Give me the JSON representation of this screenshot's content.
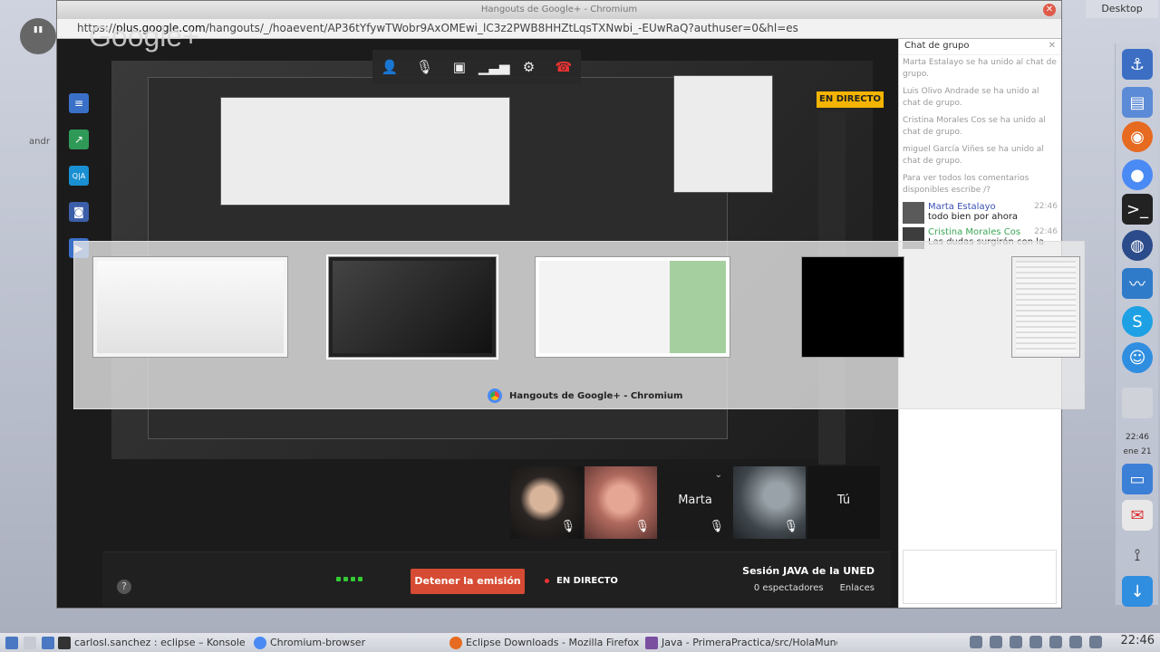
{
  "desktop": {
    "label": "Desktop",
    "left_peek": "andr"
  },
  "window": {
    "title": "Hangouts de Google+ - Chromium",
    "url_prefix": "https://",
    "url_domain": "plus.google.com",
    "url_rest": "/hangouts/_/hoaevent/AP36tYfywTWobr9AxOMEwi_lC3z2PWB8HHZtLqsTXNwbi_-EUwRaQ?authuser=0&hl=es",
    "brand": "Google+"
  },
  "toolbar": {
    "icons": [
      "add-person-icon",
      "mic-off-icon",
      "camera-off-icon",
      "signal-icon",
      "gear-icon",
      "hangup-icon"
    ]
  },
  "stage": {
    "live_badge": "EN DIRECTO"
  },
  "switcher": {
    "selected_label": "Hangouts de Google+ - Chromium"
  },
  "participants": [
    {
      "name": "",
      "muted": true
    },
    {
      "name": "",
      "muted": true
    },
    {
      "name": "Marta",
      "muted": true
    },
    {
      "name": "",
      "muted": true
    },
    {
      "name": "Tú",
      "muted": false
    }
  ],
  "bottombar": {
    "stop_label": "Detener la emisión",
    "live_label": "EN DIRECTO",
    "session_title": "Sesión JAVA de la UNED",
    "viewers": "0 espectadores",
    "links": "Enlaces"
  },
  "chat": {
    "title": "Chat de grupo",
    "system_messages": [
      "Marta Estalayo se ha unido al chat de grupo.",
      "Luis Olivo Andrade se ha unido al chat de grupo.",
      "Cristina Morales Cos se ha unido al chat de grupo.",
      "miguel García Viñes se ha unido al chat de grupo.",
      "Para ver todos los comentarios disponibles escribe /?"
    ],
    "messages": [
      {
        "author": "Marta Estalayo",
        "text": "todo bien por ahora",
        "time": "22:46",
        "color": "#3a4fb5"
      },
      {
        "author": "Cristina Morales Cos",
        "text": "Las dudas surgirán con la",
        "time": "22:46",
        "color": "#3aa757"
      }
    ]
  },
  "dock": {
    "time": "22:46",
    "date": "ene 21"
  },
  "taskbar": {
    "tasks": [
      {
        "label": "carlosl.sanchez : eclipse – Konsole",
        "color": "#333"
      },
      {
        "label": "Chromium-browser",
        "color": "#4a8af4"
      },
      {
        "label": "Eclipse Downloads - Mozilla Firefox",
        "color": "#e66a1f"
      },
      {
        "label": "Java - PrimeraPractica/src/HolaMundo.java",
        "color": "#7a4fa0"
      }
    ],
    "clock": "22:46"
  }
}
